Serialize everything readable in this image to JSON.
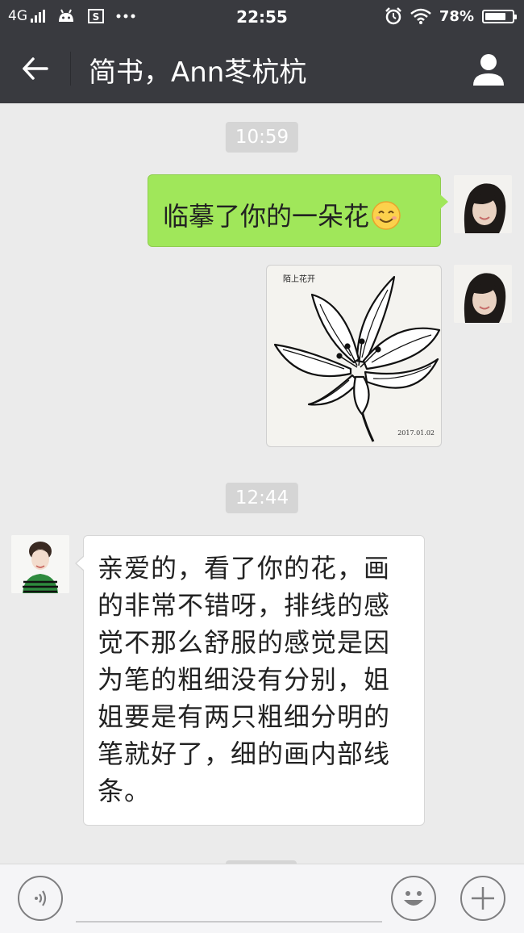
{
  "status_bar": {
    "network": "4G",
    "time": "22:55",
    "battery_percent": "78%",
    "battery_level": 0.78,
    "icons": [
      "signal-icon",
      "android-icon",
      "screenshot-icon",
      "more-dots-icon",
      "alarm-icon",
      "wifi-icon",
      "battery-icon"
    ]
  },
  "header": {
    "title": "简书，Ann苳杭杭",
    "icons": [
      "back-arrow-icon",
      "profile-icon"
    ]
  },
  "messages": [
    {
      "type": "timestamp",
      "text": "10:59"
    },
    {
      "type": "text",
      "sender": "me",
      "text": "临摹了你的一朵花",
      "emoji": "smiling-face-emoji"
    },
    {
      "type": "image",
      "sender": "me",
      "image": "lily-ink-drawing",
      "caption_top": "陌上花开",
      "caption_bottom": "2017.01.02"
    },
    {
      "type": "timestamp",
      "text": "12:44"
    },
    {
      "type": "text",
      "sender": "them",
      "text": "亲爱的，看了你的花，画的非常不错呀，排线的感觉不那么舒服的感觉是因为笔的粗细没有分别，姐姐要是有两只粗细分明的笔就好了，细的画内部线条。"
    }
  ],
  "input_bar": {
    "value": "",
    "icons": [
      "voice-icon",
      "emoji-icon",
      "plus-icon"
    ]
  },
  "colors": {
    "header_bg": "#393a3f",
    "chat_bg": "#ebebeb",
    "sent_bubble": "#a0e75a",
    "received_bubble": "#ffffff",
    "timestamp_bg": "#d5d5d5"
  }
}
